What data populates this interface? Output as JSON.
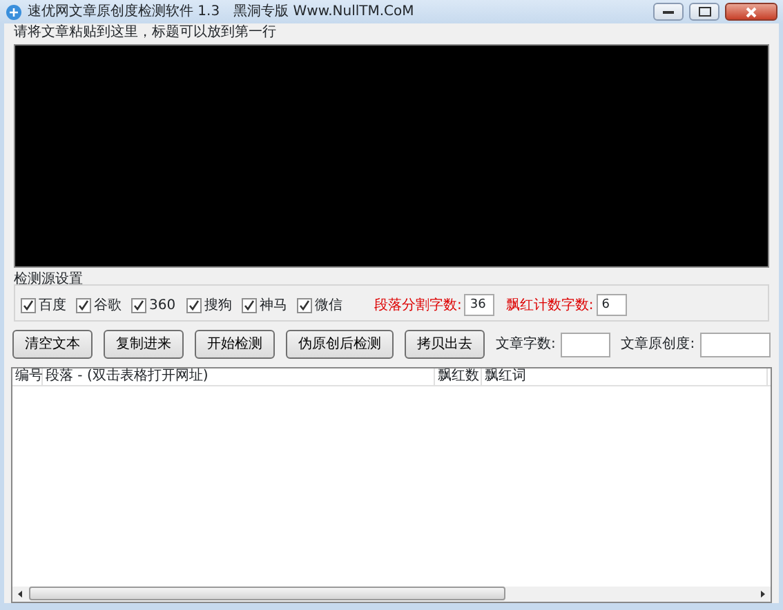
{
  "window": {
    "title": "速优网文章原创度检测软件 1.3　黑洞专版 Www.NullTM.CoM"
  },
  "paste_label": "请将文章粘贴到这里，标题可以放到第一行",
  "sources": {
    "title": "检测源设置",
    "items": [
      {
        "label": "百度",
        "checked": true
      },
      {
        "label": "谷歌",
        "checked": true
      },
      {
        "label": "360",
        "checked": true
      },
      {
        "label": "搜狗",
        "checked": true
      },
      {
        "label": "神马",
        "checked": true
      },
      {
        "label": "微信",
        "checked": true
      }
    ],
    "settings": [
      {
        "label": "段落分割字数:",
        "value": "36"
      },
      {
        "label": "飘红计数字数:",
        "value": "6"
      }
    ]
  },
  "buttons": [
    "清空文本",
    "复制进来",
    "开始检测",
    "伪原创后检测",
    "拷贝出去"
  ],
  "stats": [
    {
      "label": "文章字数:"
    },
    {
      "label": "文章原创度:"
    }
  ],
  "table": {
    "columns": [
      "编号",
      "段落 - (双击表格打开网址)",
      "飘红数",
      "飘红词"
    ]
  }
}
